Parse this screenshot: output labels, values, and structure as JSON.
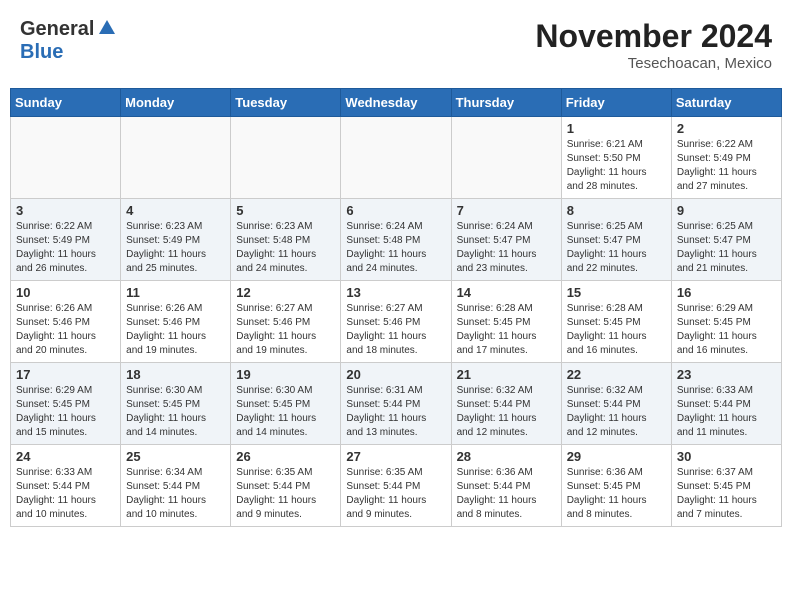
{
  "logo": {
    "general": "General",
    "blue": "Blue"
  },
  "title": "November 2024",
  "subtitle": "Tesechoacan, Mexico",
  "days_of_week": [
    "Sunday",
    "Monday",
    "Tuesday",
    "Wednesday",
    "Thursday",
    "Friday",
    "Saturday"
  ],
  "weeks": [
    [
      {
        "day": "",
        "empty": true
      },
      {
        "day": "",
        "empty": true
      },
      {
        "day": "",
        "empty": true
      },
      {
        "day": "",
        "empty": true
      },
      {
        "day": "",
        "empty": true
      },
      {
        "day": "1",
        "sunrise": "Sunrise: 6:21 AM",
        "sunset": "Sunset: 5:50 PM",
        "daylight": "Daylight: 11 hours and 28 minutes."
      },
      {
        "day": "2",
        "sunrise": "Sunrise: 6:22 AM",
        "sunset": "Sunset: 5:49 PM",
        "daylight": "Daylight: 11 hours and 27 minutes."
      }
    ],
    [
      {
        "day": "3",
        "sunrise": "Sunrise: 6:22 AM",
        "sunset": "Sunset: 5:49 PM",
        "daylight": "Daylight: 11 hours and 26 minutes."
      },
      {
        "day": "4",
        "sunrise": "Sunrise: 6:23 AM",
        "sunset": "Sunset: 5:49 PM",
        "daylight": "Daylight: 11 hours and 25 minutes."
      },
      {
        "day": "5",
        "sunrise": "Sunrise: 6:23 AM",
        "sunset": "Sunset: 5:48 PM",
        "daylight": "Daylight: 11 hours and 24 minutes."
      },
      {
        "day": "6",
        "sunrise": "Sunrise: 6:24 AM",
        "sunset": "Sunset: 5:48 PM",
        "daylight": "Daylight: 11 hours and 24 minutes."
      },
      {
        "day": "7",
        "sunrise": "Sunrise: 6:24 AM",
        "sunset": "Sunset: 5:47 PM",
        "daylight": "Daylight: 11 hours and 23 minutes."
      },
      {
        "day": "8",
        "sunrise": "Sunrise: 6:25 AM",
        "sunset": "Sunset: 5:47 PM",
        "daylight": "Daylight: 11 hours and 22 minutes."
      },
      {
        "day": "9",
        "sunrise": "Sunrise: 6:25 AM",
        "sunset": "Sunset: 5:47 PM",
        "daylight": "Daylight: 11 hours and 21 minutes."
      }
    ],
    [
      {
        "day": "10",
        "sunrise": "Sunrise: 6:26 AM",
        "sunset": "Sunset: 5:46 PM",
        "daylight": "Daylight: 11 hours and 20 minutes."
      },
      {
        "day": "11",
        "sunrise": "Sunrise: 6:26 AM",
        "sunset": "Sunset: 5:46 PM",
        "daylight": "Daylight: 11 hours and 19 minutes."
      },
      {
        "day": "12",
        "sunrise": "Sunrise: 6:27 AM",
        "sunset": "Sunset: 5:46 PM",
        "daylight": "Daylight: 11 hours and 19 minutes."
      },
      {
        "day": "13",
        "sunrise": "Sunrise: 6:27 AM",
        "sunset": "Sunset: 5:46 PM",
        "daylight": "Daylight: 11 hours and 18 minutes."
      },
      {
        "day": "14",
        "sunrise": "Sunrise: 6:28 AM",
        "sunset": "Sunset: 5:45 PM",
        "daylight": "Daylight: 11 hours and 17 minutes."
      },
      {
        "day": "15",
        "sunrise": "Sunrise: 6:28 AM",
        "sunset": "Sunset: 5:45 PM",
        "daylight": "Daylight: 11 hours and 16 minutes."
      },
      {
        "day": "16",
        "sunrise": "Sunrise: 6:29 AM",
        "sunset": "Sunset: 5:45 PM",
        "daylight": "Daylight: 11 hours and 16 minutes."
      }
    ],
    [
      {
        "day": "17",
        "sunrise": "Sunrise: 6:29 AM",
        "sunset": "Sunset: 5:45 PM",
        "daylight": "Daylight: 11 hours and 15 minutes."
      },
      {
        "day": "18",
        "sunrise": "Sunrise: 6:30 AM",
        "sunset": "Sunset: 5:45 PM",
        "daylight": "Daylight: 11 hours and 14 minutes."
      },
      {
        "day": "19",
        "sunrise": "Sunrise: 6:30 AM",
        "sunset": "Sunset: 5:45 PM",
        "daylight": "Daylight: 11 hours and 14 minutes."
      },
      {
        "day": "20",
        "sunrise": "Sunrise: 6:31 AM",
        "sunset": "Sunset: 5:44 PM",
        "daylight": "Daylight: 11 hours and 13 minutes."
      },
      {
        "day": "21",
        "sunrise": "Sunrise: 6:32 AM",
        "sunset": "Sunset: 5:44 PM",
        "daylight": "Daylight: 11 hours and 12 minutes."
      },
      {
        "day": "22",
        "sunrise": "Sunrise: 6:32 AM",
        "sunset": "Sunset: 5:44 PM",
        "daylight": "Daylight: 11 hours and 12 minutes."
      },
      {
        "day": "23",
        "sunrise": "Sunrise: 6:33 AM",
        "sunset": "Sunset: 5:44 PM",
        "daylight": "Daylight: 11 hours and 11 minutes."
      }
    ],
    [
      {
        "day": "24",
        "sunrise": "Sunrise: 6:33 AM",
        "sunset": "Sunset: 5:44 PM",
        "daylight": "Daylight: 11 hours and 10 minutes."
      },
      {
        "day": "25",
        "sunrise": "Sunrise: 6:34 AM",
        "sunset": "Sunset: 5:44 PM",
        "daylight": "Daylight: 11 hours and 10 minutes."
      },
      {
        "day": "26",
        "sunrise": "Sunrise: 6:35 AM",
        "sunset": "Sunset: 5:44 PM",
        "daylight": "Daylight: 11 hours and 9 minutes."
      },
      {
        "day": "27",
        "sunrise": "Sunrise: 6:35 AM",
        "sunset": "Sunset: 5:44 PM",
        "daylight": "Daylight: 11 hours and 9 minutes."
      },
      {
        "day": "28",
        "sunrise": "Sunrise: 6:36 AM",
        "sunset": "Sunset: 5:44 PM",
        "daylight": "Daylight: 11 hours and 8 minutes."
      },
      {
        "day": "29",
        "sunrise": "Sunrise: 6:36 AM",
        "sunset": "Sunset: 5:45 PM",
        "daylight": "Daylight: 11 hours and 8 minutes."
      },
      {
        "day": "30",
        "sunrise": "Sunrise: 6:37 AM",
        "sunset": "Sunset: 5:45 PM",
        "daylight": "Daylight: 11 hours and 7 minutes."
      }
    ]
  ]
}
